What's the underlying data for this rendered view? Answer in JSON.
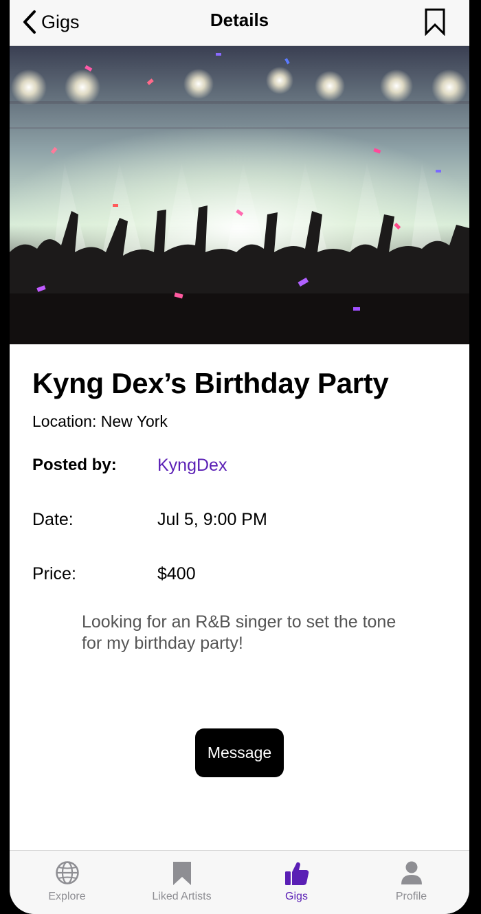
{
  "nav": {
    "back_label": "Gigs",
    "title": "Details"
  },
  "event": {
    "title": "Kyng Dex’s Birthday Party",
    "location": "Location: New York",
    "posted_by_label": "Posted by:",
    "posted_by_value": "KyngDex",
    "date_label": "Date:",
    "date_value": "Jul 5, 9:00 PM",
    "price_label": "Price:",
    "price_value": "$400",
    "description": "Looking for an R&B singer to set the tone for my birthday party!"
  },
  "actions": {
    "message_label": "Message"
  },
  "tabs": [
    {
      "label": "Explore",
      "icon": "globe-icon",
      "active": false
    },
    {
      "label": "Liked Artists",
      "icon": "bookmark-icon",
      "active": false
    },
    {
      "label": "Gigs",
      "icon": "thumbs-up-icon",
      "active": true
    },
    {
      "label": "Profile",
      "icon": "person-icon",
      "active": false
    }
  ],
  "colors": {
    "accent": "#5a1fb5",
    "inactive_tab": "#8e8e93",
    "button_bg": "#000000"
  }
}
